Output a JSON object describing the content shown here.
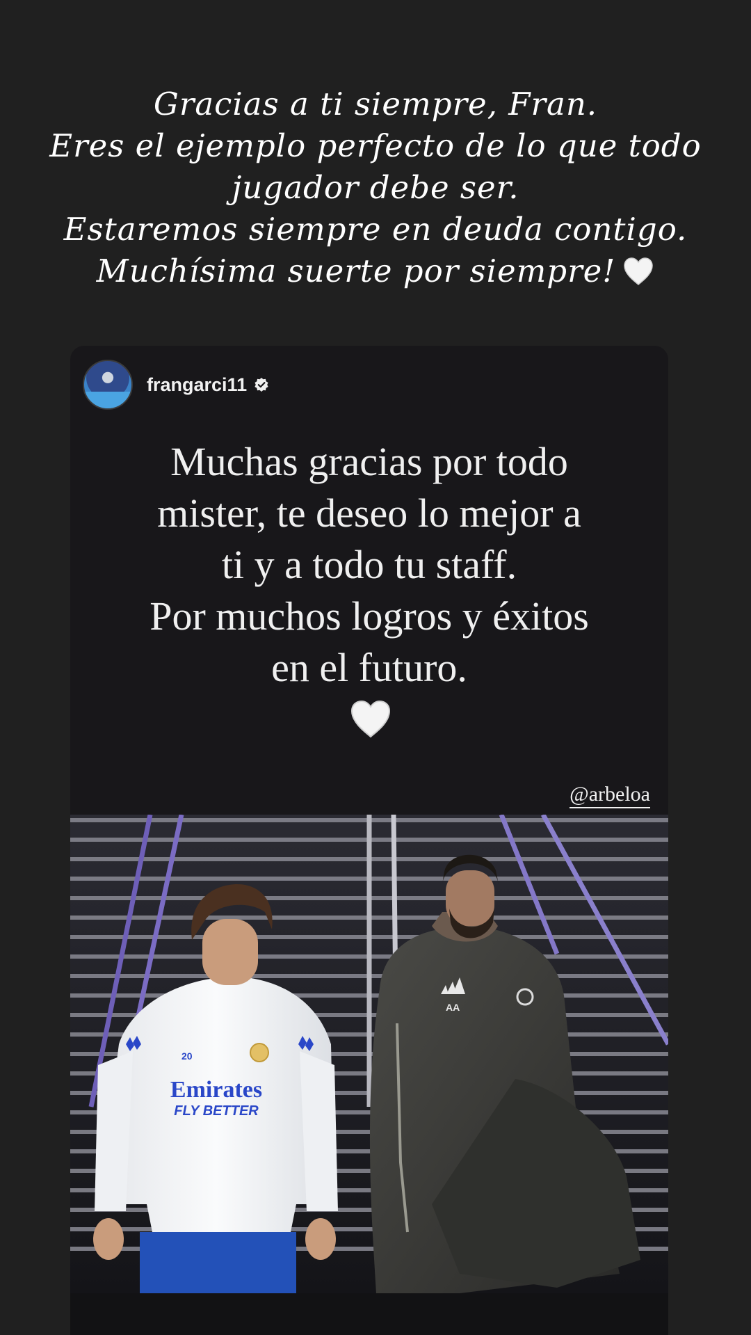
{
  "caption": {
    "lines": [
      "Gracias a ti siempre, Fran.",
      "Eres el ejemplo perfecto de lo que todo",
      "jugador debe ser.",
      "Estaremos siempre en deuda contigo.",
      "Muchísima suerte por siempre!"
    ],
    "trailing_emoji": "white-heart"
  },
  "shared_post": {
    "username": "frangarci11",
    "verified": true,
    "text_lines": [
      "Muchas gracias por todo",
      "mister, te deseo lo mejor a",
      "ti y a todo tu staff.",
      "Por muchos logros y éxitos",
      "en el futuro."
    ],
    "emoji": "white-heart",
    "mention": "@arbeloa",
    "photo": {
      "left_player": {
        "number": "20",
        "sponsor_line1": "Emirates",
        "sponsor_line2": "FLY BETTER"
      },
      "right_person": {
        "initials": "AA"
      }
    }
  }
}
